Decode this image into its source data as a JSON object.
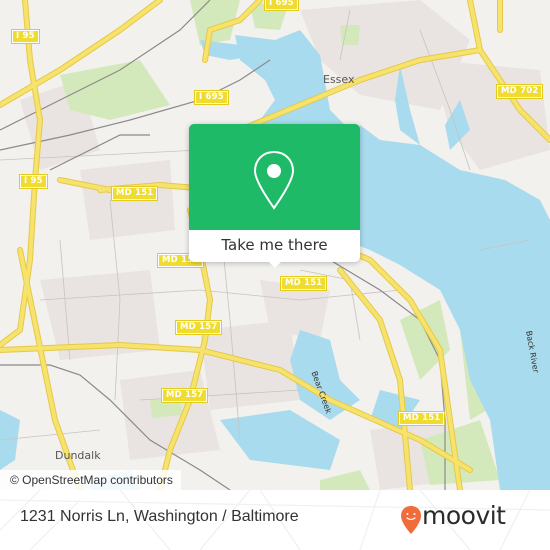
{
  "map": {
    "road_shields": [
      {
        "id": "i695-top",
        "text": "I 695"
      },
      {
        "id": "i95-north",
        "text": "I 95"
      },
      {
        "id": "i695-mid",
        "text": "I 695"
      },
      {
        "id": "i95-mid",
        "text": "I 95"
      },
      {
        "id": "md151-west",
        "text": "MD 151"
      },
      {
        "id": "md151-left",
        "text": "MD 151"
      },
      {
        "id": "md151-center",
        "text": "MD 151"
      },
      {
        "id": "md157-upper",
        "text": "MD 157"
      },
      {
        "id": "md157-lower",
        "text": "MD 157"
      },
      {
        "id": "md151-south",
        "text": "MD 151"
      },
      {
        "id": "md702",
        "text": "MD 702"
      }
    ],
    "places": [
      {
        "id": "essex",
        "text": "Essex"
      },
      {
        "id": "dundalk",
        "text": "Dundalk"
      }
    ],
    "water_labels": [
      {
        "id": "bear-creek",
        "text": "Bear Creek"
      },
      {
        "id": "back-river",
        "text": "Back River"
      }
    ],
    "colors": {
      "land": "#f2f1ee",
      "water": "#a9dbee",
      "park": "#d4e9bb",
      "road": "#f4e16a",
      "residential": "#e9e4e1",
      "rail": "#888888"
    }
  },
  "attribution": "© OpenStreetMap contributors",
  "popup": {
    "icon": "map-pin-icon",
    "button_label": "Take me there",
    "color": "#1fba67"
  },
  "footer": {
    "address": "1231 Norris Ln, Washington / Baltimore",
    "brand": "moovit",
    "brand_color": "#f26b3a"
  }
}
